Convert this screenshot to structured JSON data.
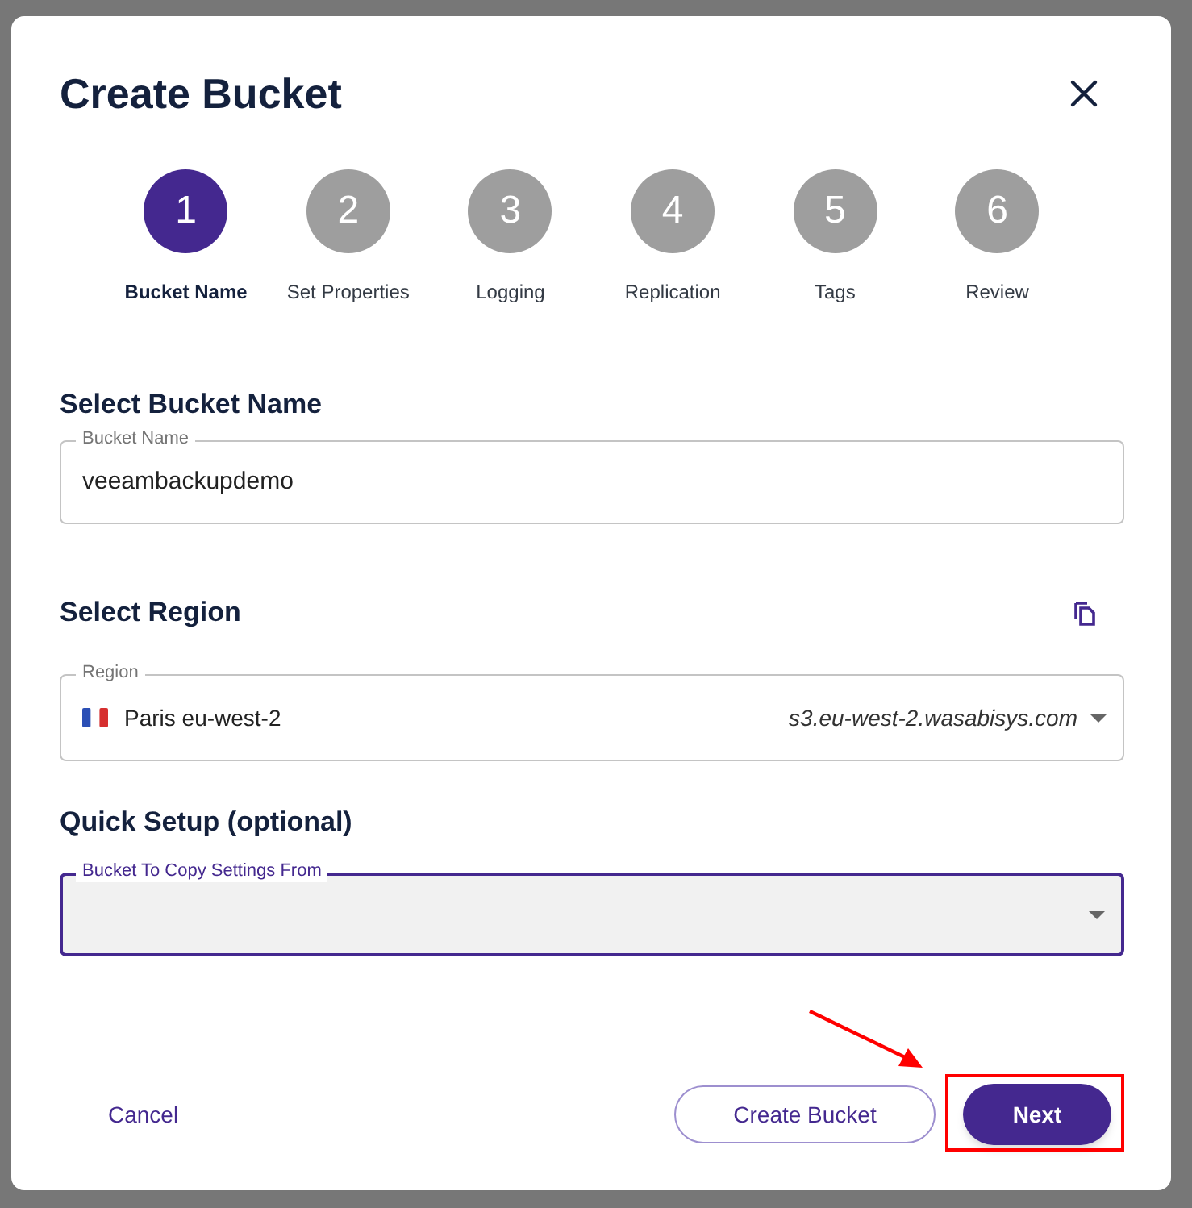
{
  "dialog": {
    "title": "Create Bucket"
  },
  "steps": [
    {
      "number": "1",
      "label": "Bucket Name",
      "selected": true
    },
    {
      "number": "2",
      "label": "Set Properties",
      "selected": false
    },
    {
      "number": "3",
      "label": "Logging",
      "selected": false
    },
    {
      "number": "4",
      "label": "Replication",
      "selected": false
    },
    {
      "number": "5",
      "label": "Tags",
      "selected": false
    },
    {
      "number": "6",
      "label": "Review",
      "selected": false
    }
  ],
  "bucket_name": {
    "heading": "Select Bucket Name",
    "label": "Bucket Name",
    "value": "veeambackupdemo"
  },
  "region": {
    "heading": "Select Region",
    "label": "Region",
    "value": "Paris eu-west-2",
    "endpoint": "s3.eu-west-2.wasabisys.com"
  },
  "quick_setup": {
    "heading": "Quick Setup (optional)",
    "label": "Bucket To Copy Settings From",
    "focused": true
  },
  "buttons": {
    "cancel": "Cancel",
    "create": "Create Bucket",
    "next": "Next"
  }
}
